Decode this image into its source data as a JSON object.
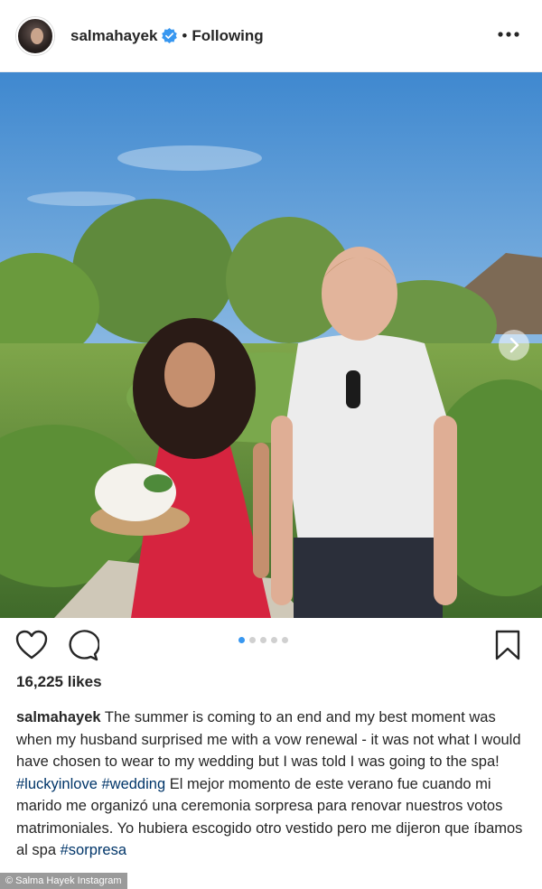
{
  "post": {
    "username": "salmahayek",
    "separator": "•",
    "follow_status": "Following",
    "more_icon": "more-horizontal-icon",
    "verified_icon": "verified-badge-icon",
    "verified_color": "#3897f0"
  },
  "photo": {
    "description_icon": "photo",
    "carousel_count": 5,
    "carousel_active": 1
  },
  "actions": {
    "like_icon": "heart-icon",
    "comment_icon": "comment-icon",
    "save_icon": "bookmark-icon"
  },
  "likes": "16,225 likes",
  "caption": {
    "username": "salmahayek",
    "text_1": " The summer is coming to an end and my best moment was when my husband surprised me with a vow renewal - it was not what I would have chosen to wear to my wedding but I was told I was going to the spa! ",
    "tag_1": "#luckyinlove",
    "space": " ",
    "tag_2": "#wedding",
    "text_2": " El mejor momento de este verano fue cuando mi marido me organizó una ceremonia sorpresa para renovar nuestros votos matrimoniales. Yo hubiera escogido otro vestido pero me dijeron que íbamos al spa ",
    "tag_3": "#sorpresa"
  },
  "watermark": "© Salma Hayek Instagram",
  "colors": {
    "hashtag": "#003569",
    "active_dot": "#3897f0",
    "text": "#262626"
  }
}
